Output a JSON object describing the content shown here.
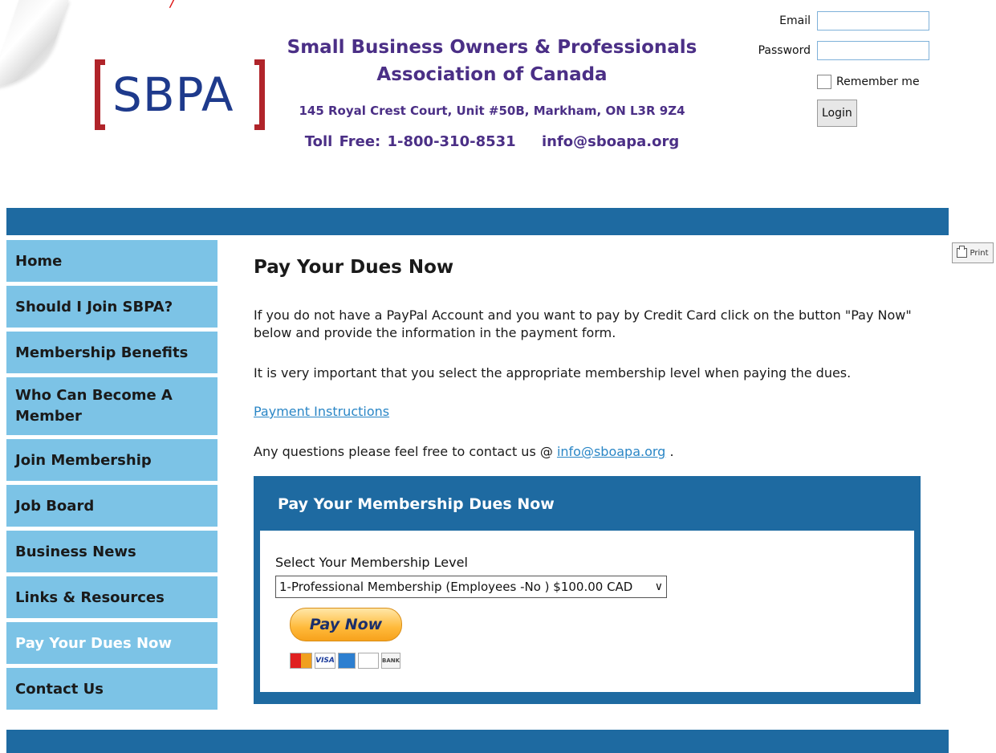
{
  "org": {
    "logo_text": "SBPA",
    "name_line1": "Small Business Owners & Professionals",
    "name_line2": "Association of Canada",
    "address": "145 Royal Crest Court, Unit #50B, Markham, ON L3R 9Z4",
    "toll_free": "Toll Free: 1-800-310-8531",
    "email": "info@sboapa.org"
  },
  "login": {
    "email_label": "Email",
    "email_value": "",
    "password_label": "Password",
    "password_value": "",
    "remember_label": "Remember me",
    "remember_checked": false,
    "login_button": "Login"
  },
  "print_button": "Print",
  "sidebar": {
    "items": [
      {
        "label": "Home",
        "active": false
      },
      {
        "label": "Should I Join SBPA?",
        "active": false
      },
      {
        "label": "Membership Benefits",
        "active": false
      },
      {
        "label": "Who Can Become A Member",
        "active": false
      },
      {
        "label": "Join Membership",
        "active": false
      },
      {
        "label": "Job Board",
        "active": false
      },
      {
        "label": "Business News",
        "active": false
      },
      {
        "label": "Links & Resources",
        "active": false
      },
      {
        "label": "Pay Your Dues Now",
        "active": true
      },
      {
        "label": "Contact Us",
        "active": false
      }
    ]
  },
  "main": {
    "title": "Pay Your Dues Now",
    "paragraph1": "If you do not have a PayPal Account and you want to pay by Credit Card click on the button \"Pay Now\" below and provide the information in the payment form.",
    "paragraph2": "It is very important that you select the appropriate membership level when paying the dues.",
    "instructions_link": "Payment Instructions",
    "questions_prefix": "Any questions please feel free to contact us @",
    "questions_email": "info@sboapa.org",
    "questions_suffix": "."
  },
  "dues_panel": {
    "title": "Pay Your Membership Dues Now",
    "select_label": "Select Your Membership Level",
    "selected_option": "1-Professional Membership (Employees -No ) $100.00 CAD",
    "paynow_label": "Pay Now",
    "card_logos": [
      "mastercard-icon",
      "visa-icon",
      "amex-icon",
      "discover-icon",
      "bank-icon"
    ]
  },
  "colors": {
    "brand_blue": "#1e6aa1",
    "nav_bg": "#7cc3e6",
    "org_purple": "#4b2f86",
    "logo_red": "#b0242a",
    "logo_blue": "#1e3a8c"
  }
}
